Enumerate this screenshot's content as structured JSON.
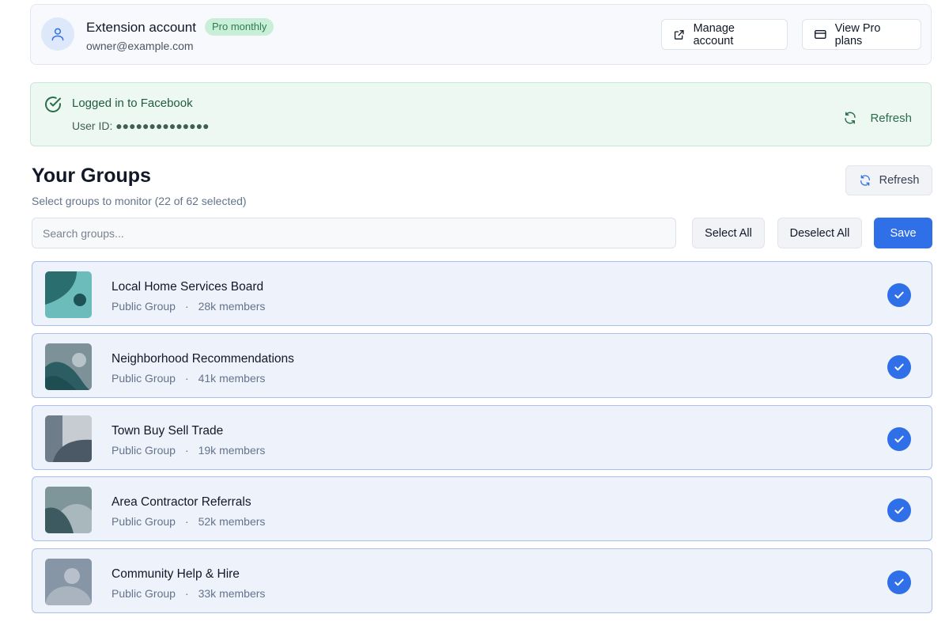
{
  "account": {
    "title": "Extension account",
    "plan": "Pro monthly",
    "email": "owner@example.com",
    "manage_label": "Manage account",
    "plans_label": "View Pro plans"
  },
  "login": {
    "title": "Logged in to Facebook",
    "user_id": "User ID: ●●●●●●●●●●●●●●",
    "refresh_label": "Refresh"
  },
  "groups": {
    "title": "Your Groups",
    "subtitle": "Select groups to monitor (22 of 62 selected)",
    "refresh_label": "Refresh",
    "search_placeholder": "Search groups...",
    "select_all": "Select All",
    "deselect_all": "Deselect All",
    "save": "Save",
    "items": [
      {
        "name": "Local Home Services Board",
        "type": "Public Group",
        "members": "28k members",
        "selected": true
      },
      {
        "name": "Neighborhood Recommendations",
        "type": "Public Group",
        "members": "41k members",
        "selected": true
      },
      {
        "name": "Town Buy Sell Trade",
        "type": "Public Group",
        "members": "19k members",
        "selected": true
      },
      {
        "name": "Area Contractor Referrals",
        "type": "Public Group",
        "members": "52k members",
        "selected": true
      },
      {
        "name": "Community Help & Hire",
        "type": "Public Group",
        "members": "33k members",
        "selected": true
      }
    ]
  },
  "colors": {
    "accent": "#2f6fe8",
    "success_bg": "#edf8f2",
    "success_text": "#1f5c3f",
    "badge_bg": "#c9efd9"
  },
  "icons": {
    "avatar": "user-icon",
    "manage": "external-link-icon",
    "plans": "credit-card-icon",
    "login": "check-circle-icon",
    "refresh": "refresh-icon",
    "selected": "checkmark-icon"
  }
}
